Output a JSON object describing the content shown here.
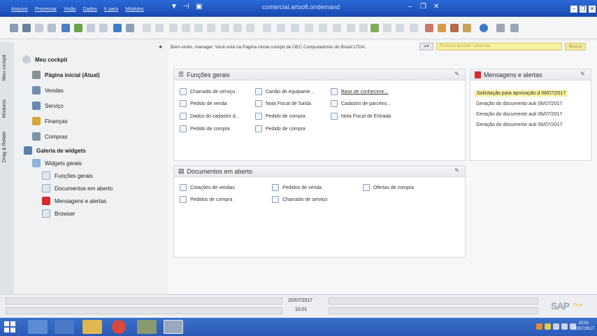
{
  "window": {
    "title": "comercial.artsoft.ondemand",
    "menus": [
      "Arquivo",
      "Processar",
      "Visão",
      "Dados",
      "Ir para",
      "Módulos"
    ]
  },
  "vtabs": [
    "Meu cockpit",
    "Módulos",
    "Drag & Relate"
  ],
  "sidebar": {
    "cockpit_label": "Meu cockpit",
    "items": [
      {
        "label": "Página inicial (Atual)",
        "icon": "home-icon"
      },
      {
        "label": "Vendas",
        "icon": "sales-icon"
      },
      {
        "label": "Serviço",
        "icon": "service-icon"
      },
      {
        "label": "Finanças",
        "icon": "finance-icon"
      },
      {
        "label": "Compras",
        "icon": "cart-icon"
      }
    ],
    "gallery_label": "Galeria de widgets",
    "widgets_label": "Widgets gerais",
    "widgets": [
      "Funções gerais",
      "Documentos em aberto",
      "Mensagens e alertas",
      "Browser"
    ]
  },
  "welcome_text": "Bem-vindo, manager. Você está na Página inicial cockpit de OEC Computadores do Brasil LTDA.",
  "search": {
    "placeholder": "Procurar produto / pessoas",
    "button": "Busca"
  },
  "functions_panel": {
    "title": "Funções gerais",
    "links": [
      "Chamado de serviço",
      "Cartão de equipame...",
      "Base de conhecime...",
      "Pedido de venda",
      "Nota Fiscal de Saída",
      "Cadastro de parceiro...",
      "Dados do cadastro d...",
      "Pedido de compra",
      "Nota Fiscal de Entrada",
      "Pedido de compra",
      "Pedido de compra"
    ]
  },
  "docs_panel": {
    "title": "Documentos em aberto",
    "links": [
      "Cotações de vendas",
      "Pedidos de venda",
      "Ofertas de compra",
      "Pedidos de compra",
      "Chamado de serviço"
    ]
  },
  "alerts_panel": {
    "title": "Mensagens e alertas",
    "items": [
      "Solicitação para aprovação d 06/07/2017",
      "Geração do documento auti 06/07/2017",
      "Geração do documento auti 06/07/2017",
      "Geração do documento auti 06/07/2017"
    ]
  },
  "status": {
    "date": "20/07/2017",
    "time": "10:01"
  },
  "sap": {
    "logo": "SAP",
    "sub": "One"
  },
  "taskbar": {
    "time": "10:01",
    "date": "20/07/2017"
  },
  "colors": {
    "accent": "#2a6ad6",
    "highlight": "#f8f29c"
  }
}
